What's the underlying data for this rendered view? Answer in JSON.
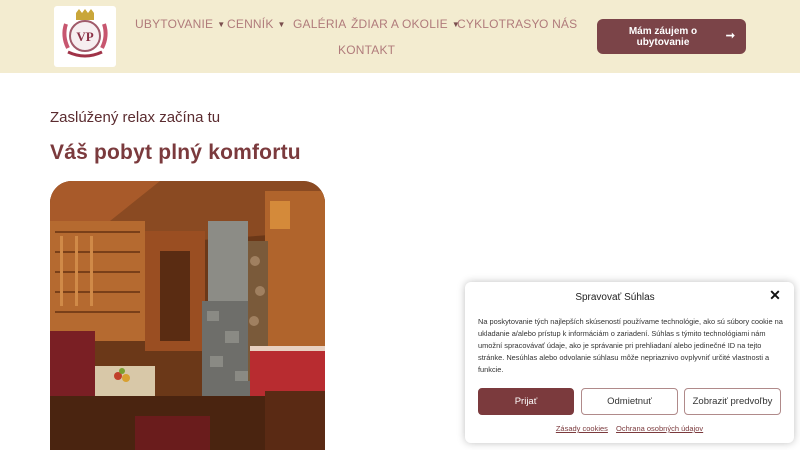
{
  "header": {
    "nav": [
      {
        "label": "UBYTOVANIE",
        "dropdown": true
      },
      {
        "label": "CENNÍK",
        "dropdown": true
      },
      {
        "label": "GALÉRIA",
        "dropdown": false
      },
      {
        "label": "ŽDIAR A OKOLIE",
        "dropdown": true
      },
      {
        "label": "CYKLOTRASY",
        "dropdown": false
      },
      {
        "label": "O NÁS",
        "dropdown": false
      },
      {
        "label": "KONTAKT",
        "dropdown": false
      }
    ],
    "cta_label": "Mám záujem o ubytovanie",
    "cta_icon": "arrow-right-icon",
    "logo_icon": "vp-crest-logo"
  },
  "main": {
    "subtitle": "Zaslúžený relax začína tu",
    "title": "Váš pobyt plný komfortu"
  },
  "cookie": {
    "title": "Spravovať Súhlas",
    "text": "Na poskytovanie tých najlepších skúseností používame technológie, ako sú súbory cookie na ukladanie a/alebo prístup k informáciám o zariadení. Súhlas s týmito technológiami nám umožní spracovávať údaje, ako je správanie pri prehliadaní alebo jedinečné ID na tejto stránke. Nesúhlas alebo odvolanie súhlasu môže nepriaznivo ovplyvniť určité vlastnosti a funkcie.",
    "accept_label": "Prijať",
    "deny_label": "Odmietnuť",
    "prefs_label": "Zobraziť predvoľby",
    "link_cookies": "Zásady cookies",
    "link_privacy": "Ochrana osobných údajov"
  },
  "colors": {
    "header_bg": "#f3ecd0",
    "accent": "#7b3a3d",
    "nav_text": "#b07b7b"
  }
}
